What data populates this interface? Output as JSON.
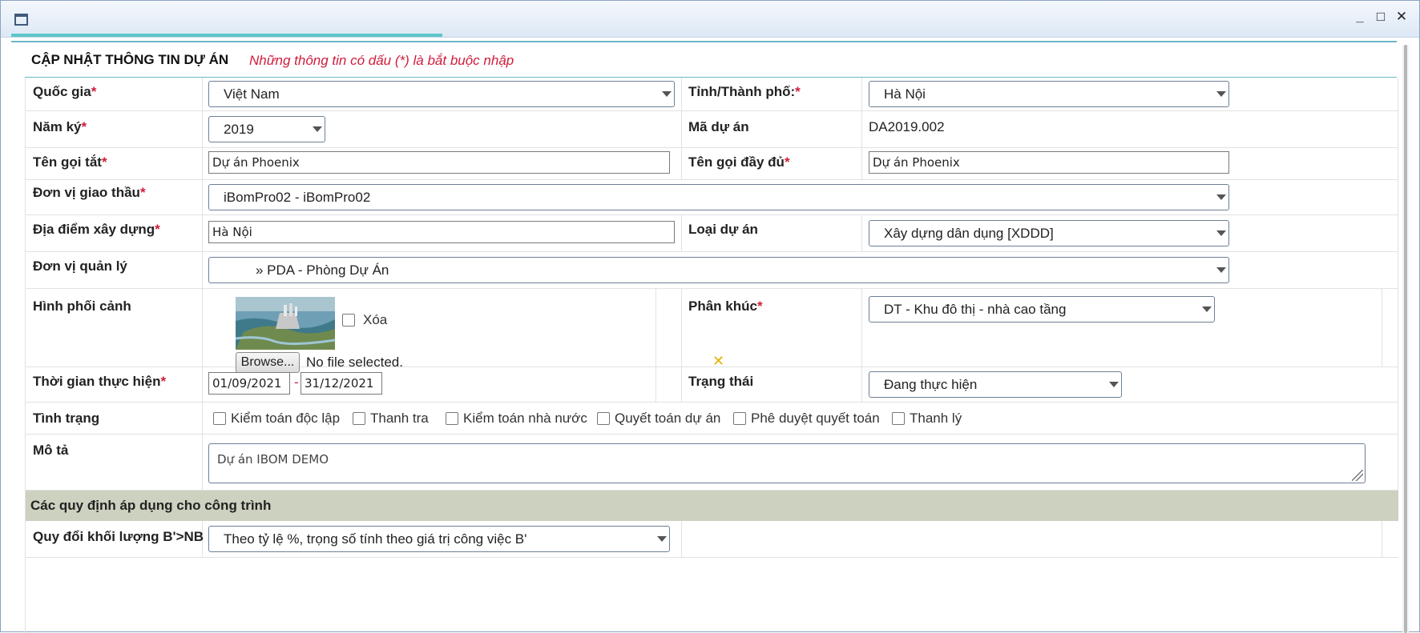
{
  "window": {
    "icon": "window-icon",
    "controls": {
      "minimize": "_",
      "maximize": "□",
      "close": "✕"
    }
  },
  "heading": {
    "title": "CẬP NHẬT THÔNG TIN DỰ ÁN",
    "note": "Những thông tin có dấu (*) là bắt buộc nhập"
  },
  "colors": {
    "required": "#d01c3b",
    "accent": "#5bc7c9",
    "section_bg": "#cdd1c0"
  },
  "fields": {
    "country": {
      "label": "Quốc gia",
      "req": "*",
      "value": "Việt Nam"
    },
    "province": {
      "label": "Tỉnh/Thành phố:",
      "req": "*",
      "value": "Hà Nội"
    },
    "year": {
      "label": "Năm ký",
      "req": "*",
      "value": "2019"
    },
    "project_code": {
      "label": "Mã dự án",
      "value": "DA2019.002"
    },
    "short_name": {
      "label": "Tên gọi tắt",
      "req": "*",
      "value": "Dự án Phoenix"
    },
    "full_name": {
      "label": "Tên gọi đầy đủ",
      "req": "*",
      "value": "Dự án Phoenix"
    },
    "contractor": {
      "label": "Đơn vị giao thầu",
      "req": "*",
      "value": "iBomPro02 - iBomPro02"
    },
    "location": {
      "label": "Địa điểm xây dựng",
      "req": "*",
      "value": "Hà Nội"
    },
    "project_type": {
      "label": "Loại dự án",
      "value": "Xây dựng dân dụng [XDDD]"
    },
    "management_unit": {
      "label": "Đơn vị quản lý",
      "value": "» PDA - Phòng Dự Án"
    },
    "perspective": {
      "label": "Hình phối cảnh",
      "delete_label": "Xóa",
      "browse_label": "Browse...",
      "file_status": "No file selected."
    },
    "segment": {
      "label": "Phân khúc",
      "req": "*",
      "value": "DT - Khu đô thị - nhà cao tầng"
    },
    "duration": {
      "label": "Thời gian thực hiện",
      "req": "*",
      "start": "01/09/2021",
      "separator": "-",
      "end": "31/12/2021"
    },
    "status": {
      "label": "Trạng thái",
      "value": "Đang thực hiện"
    },
    "condition": {
      "label": "Tình trạng",
      "options": [
        "Kiểm toán độc lập",
        "Thanh tra",
        "Kiểm toán nhà nước",
        "Quyết toán dự án",
        "Phê duyệt quyết toán",
        "Thanh lý"
      ]
    },
    "description": {
      "label": "Mô tả",
      "value": "Dự án IBOM DEMO"
    }
  },
  "section": {
    "title": "Các quy định áp dụng cho công trình"
  },
  "conversion": {
    "label": "Quy đổi khối lượng B'>NB",
    "value": "Theo tỷ lệ %, trọng số tính theo giá trị công việc B'"
  }
}
